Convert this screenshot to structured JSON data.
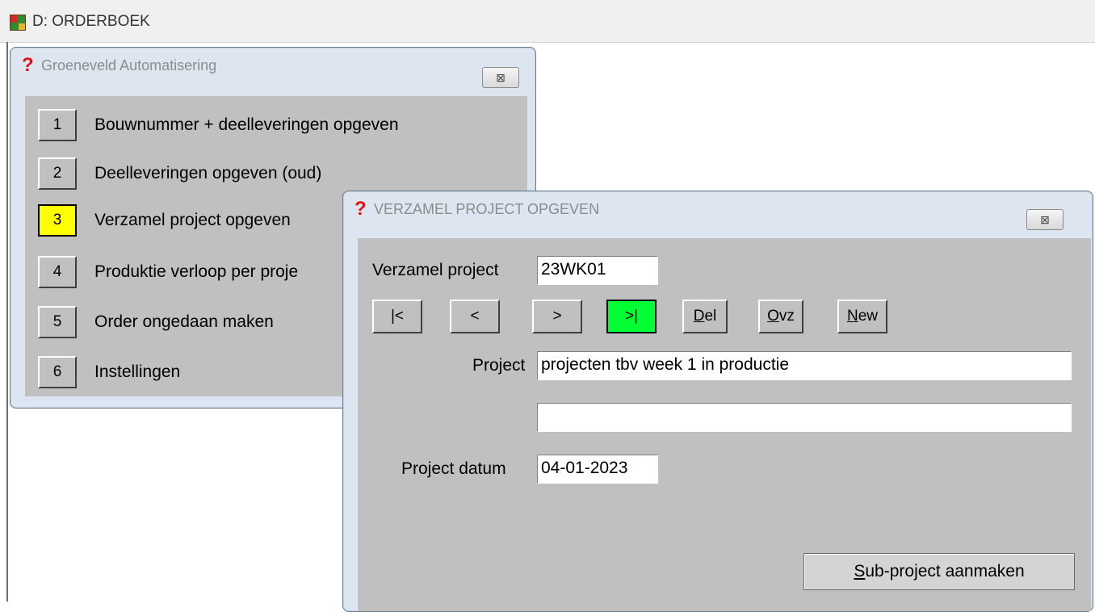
{
  "app": {
    "title": "D: ORDERBOEK"
  },
  "menu_dialog": {
    "title": "Groeneveld Automatisering",
    "close_glyph": "⊠",
    "items": [
      {
        "num": "1",
        "label": "Bouwnummer + deelleveringen opgeven"
      },
      {
        "num": "2",
        "label": "Deelleveringen opgeven (oud)"
      },
      {
        "num": "3",
        "label": "Verzamel project opgeven"
      },
      {
        "num": "4",
        "label": "Produktie verloop per proje"
      },
      {
        "num": "5",
        "label": "Order ongedaan maken"
      },
      {
        "num": "6",
        "label": "Instellingen"
      }
    ],
    "active_item": "3",
    "active_color": "#ffff00"
  },
  "project_dialog": {
    "title": "VERZAMEL PROJECT OPGEVEN",
    "close_glyph": "⊠",
    "verzamel_label": "Verzamel project",
    "verzamel_value": "23WK01",
    "nav": {
      "first": "|<",
      "prev": "<",
      "next": ">",
      "last": ">|",
      "del_u": "D",
      "del_rest": "el",
      "ovz_u": "O",
      "ovz_rest": "vz",
      "new_u": "N",
      "new_rest": "ew"
    },
    "last_button_color": "#00ff33",
    "project_label": "Project",
    "project_value": "projecten tbv week 1 in productie",
    "project_value2": "",
    "datum_label": "Project datum",
    "datum_value": "04-01-2023",
    "sub_button_u": "S",
    "sub_button_rest": "ub-project aanmaken"
  },
  "icons": [
    "app-icon",
    "question-icon",
    "close-icon"
  ]
}
